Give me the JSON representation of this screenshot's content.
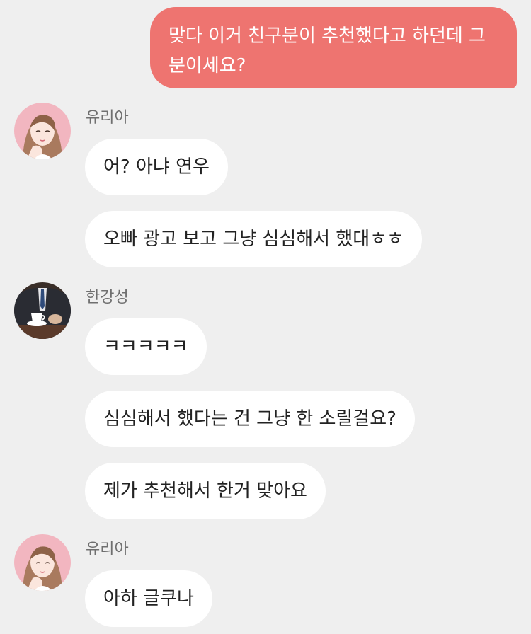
{
  "colors": {
    "background": "#efefef",
    "my_bubble": "#ee7470",
    "their_bubble": "#ffffff",
    "name_text": "#6f6f6f"
  },
  "messages": {
    "m0": {
      "text": "맞다 이거 친구분이 추천했다고 하던데 그분이세요?"
    },
    "g1": {
      "sender": "유리아",
      "avatar": "woman-illustration-avatar",
      "m1": "어? 아냐 연우",
      "m2": "오빠 광고 보고 그냥 심심해서 했대ㅎㅎ"
    },
    "g2": {
      "sender": "한강성",
      "avatar": "man-suit-coffee-avatar",
      "m1": "ㅋㅋㅋㅋㅋ",
      "m2": "심심해서 했다는 건 그냥 한 소릴걸요?",
      "m3": "제가 추천해서 한거 맞아요"
    },
    "g3": {
      "sender": "유리아",
      "avatar": "woman-illustration-avatar",
      "m1": "아하 글쿠나"
    }
  }
}
